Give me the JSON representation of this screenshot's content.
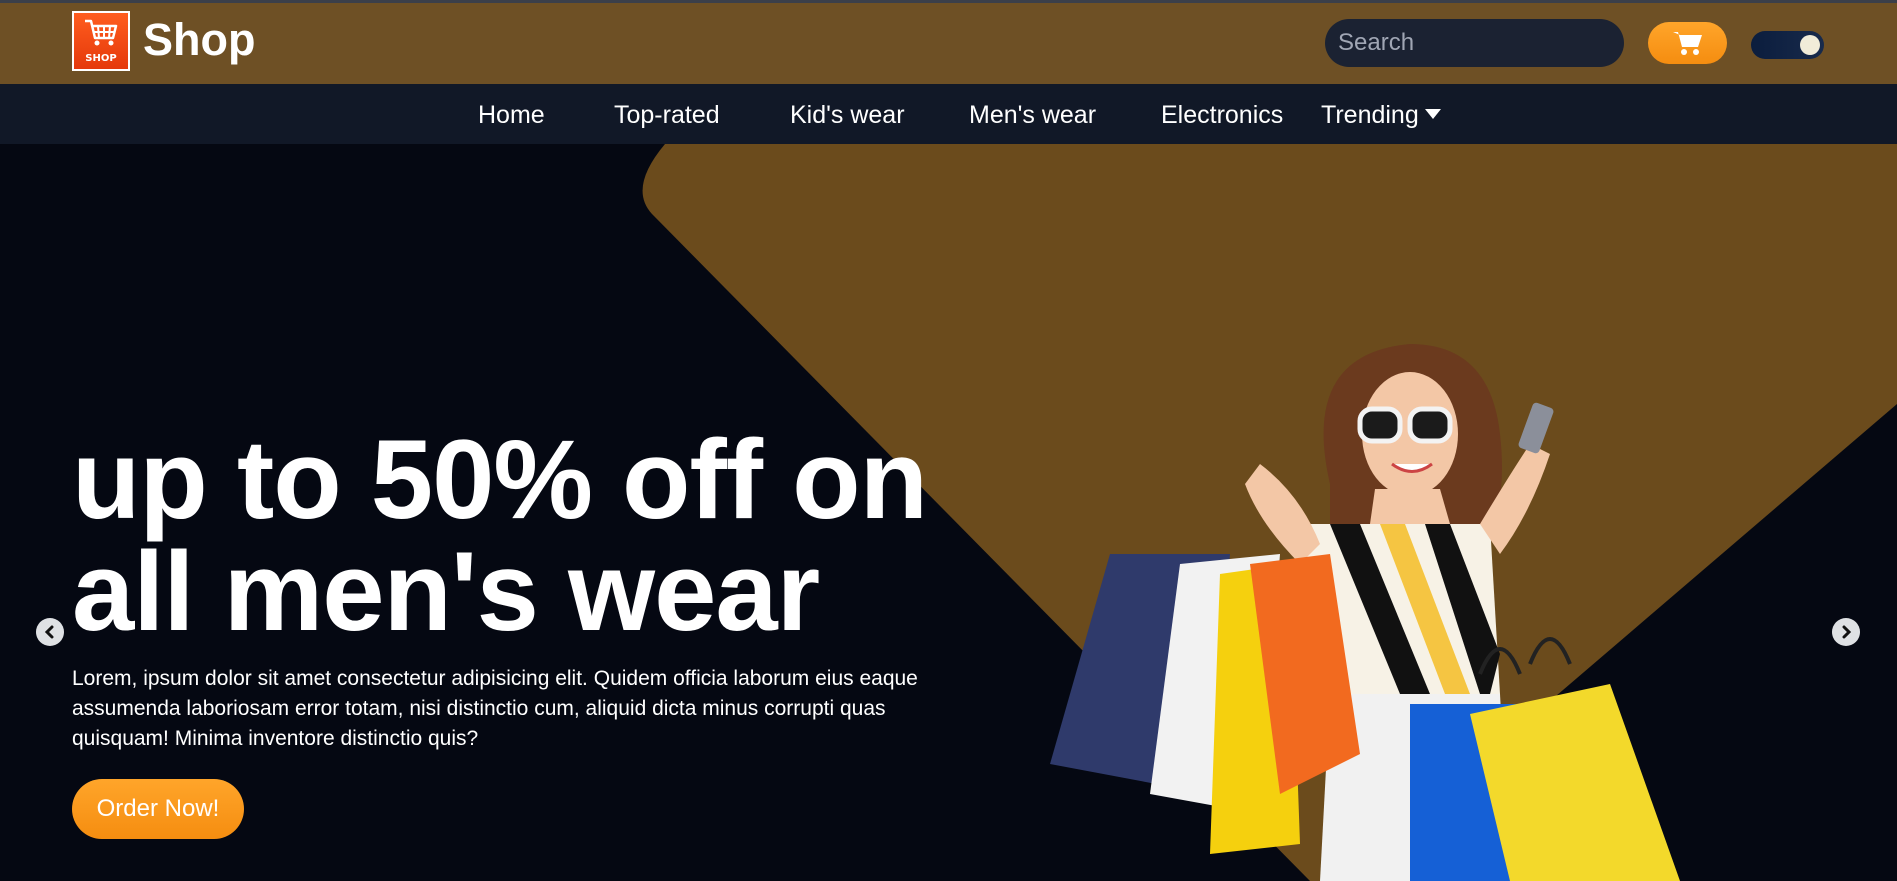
{
  "header": {
    "logo_text": "SHOP",
    "brand": "Shop",
    "search_placeholder": "Search",
    "colors": {
      "bar": "#6e5025",
      "accent": "#f7961a"
    }
  },
  "nav": {
    "items": [
      {
        "label": "Home"
      },
      {
        "label": "Top-rated"
      },
      {
        "label": "Kid's wear"
      },
      {
        "label": "Men's wear"
      },
      {
        "label": "Electronics"
      },
      {
        "label": "Trending"
      }
    ]
  },
  "hero": {
    "headline_line1": "up to 50% off on",
    "headline_line2": "all men's wear",
    "description": "Lorem, ipsum dolor sit amet consectetur adipisicing elit. Quidem officia laborum eius eaque assumenda laboriosam error totam, nisi distinctio cum, aliquid dicta minus corrupti quas quisquam! Minima inventore distinctio quis?",
    "cta_label": "Order Now!",
    "icons": [
      "chevron-left-icon",
      "chevron-right-icon"
    ]
  }
}
